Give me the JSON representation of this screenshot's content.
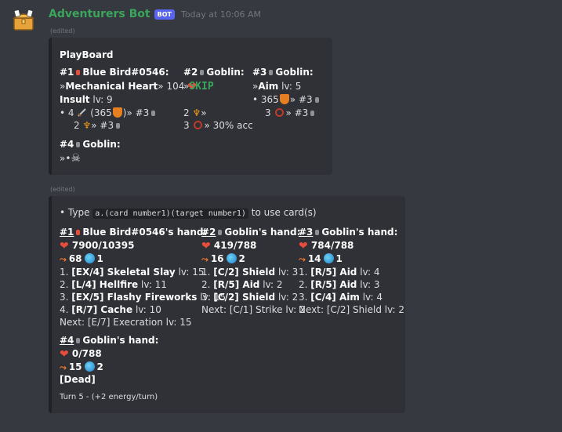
{
  "message": {
    "username": "Adventurers Bot",
    "bot_tag": "BOT",
    "timestamp": "Today at 10:06 AM",
    "edited": "(edited)"
  },
  "board": {
    "title": "PlayBoard",
    "p1": {
      "header_num": "#1",
      "header_name": "Blue Bird#0546:",
      "line1_prefix": "»",
      "line1_name": "Mechanical Heart",
      "line1_suffix": "» 104",
      "line2_name": "Insult",
      "line2_lv": "lv: 9",
      "line3_a": "• 4",
      "line3_b": "(365",
      "line3_c": ")» #3",
      "line4_a": "2",
      "line4_b": "» #3"
    },
    "p2": {
      "header_num": "#2",
      "header_name": "Goblin:",
      "line1_prefix": "»",
      "line1_skip": "SKIP",
      "line3_a": "2",
      "line3_b": "»",
      "line4_a": "3",
      "line4_b": "» 30% acc"
    },
    "p3": {
      "header_num": "#3",
      "header_name": "Goblin:",
      "line1_prefix": "»",
      "line1_name": "Aim",
      "line1_lv": "lv: 5",
      "line2_a": "• 365",
      "line2_b": "» #3",
      "line3_a": "3",
      "line3_b": "» #3"
    },
    "p4": {
      "header_num": "#4",
      "header_name": "Goblin:",
      "line1": "»•"
    }
  },
  "hands": {
    "instruction_prefix": "• Type",
    "instruction_code": "a.(card number1)(target number1)",
    "instruction_suffix": "to use card(s)",
    "p1": {
      "num": "#1",
      "name": "Blue Bird#0546's hand:",
      "hp": "7900/10395",
      "energy": "68",
      "mana": "1",
      "cards": [
        {
          "prefix": "1.",
          "tag": "[EX/4] Skeletal Slay",
          "lv": "lv: 15"
        },
        {
          "prefix": "2.",
          "tag": "[L/4] Hellfire",
          "lv": "lv: 11"
        },
        {
          "prefix": "3.",
          "tag": "[EX/5] Flashy Fireworks",
          "lv": "lv: 15"
        },
        {
          "prefix": "4.",
          "tag": "[R/7] Cache",
          "lv": "lv: 10"
        }
      ],
      "next": "Next: [E/7] Execration lv: 15"
    },
    "p2": {
      "num": "#2",
      "name": "Goblin's hand:",
      "hp": "419/788",
      "energy": "16",
      "mana": "2",
      "cards": [
        {
          "prefix": "1.",
          "tag": "[C/2] Shield",
          "lv": "lv: 3"
        },
        {
          "prefix": "2.",
          "tag": "[R/5] Aid",
          "lv": "lv: 2"
        },
        {
          "prefix": "3.",
          "tag": "[C/2] Shield",
          "lv": "lv: 2"
        }
      ],
      "next": "Next: [C/1] Strike lv: 2"
    },
    "p3": {
      "num": "#3",
      "name": "Goblin's hand:",
      "hp": "784/788",
      "energy": "14",
      "mana": "1",
      "cards": [
        {
          "prefix": "1.",
          "tag": "[R/5] Aid",
          "lv": "lv: 4"
        },
        {
          "prefix": "2.",
          "tag": "[R/5] Aid",
          "lv": "lv: 3"
        },
        {
          "prefix": "3.",
          "tag": "[C/4] Aim",
          "lv": "lv: 4"
        }
      ],
      "next": "Next: [C/2] Shield lv: 2"
    },
    "p4": {
      "num": "#4",
      "name": "Goblin's hand:",
      "hp": "0/788",
      "energy": "15",
      "mana": "2",
      "status": "[Dead]"
    },
    "footer": "Turn 5 - (+2 energy/turn)"
  },
  "colors": {
    "background": "#36393f",
    "embed": "#2f3136",
    "username": "#3ba55c",
    "bot_tag": "#5865f2",
    "heart": "#e74c3c",
    "skip": "#3ba55c"
  },
  "icons": [
    "treasure-chest-avatar-icon",
    "heart-icon",
    "shield-icon",
    "sword-icon",
    "running-person-icon",
    "target-icon",
    "skull-icon",
    "globe-icon",
    "energy-icon"
  ]
}
